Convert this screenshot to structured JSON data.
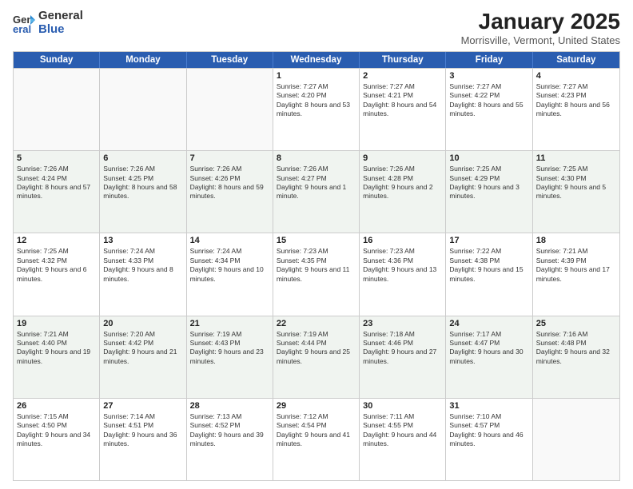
{
  "header": {
    "logo_general": "General",
    "logo_blue": "Blue",
    "month_title": "January 2025",
    "location": "Morrisville, Vermont, United States"
  },
  "days_of_week": [
    "Sunday",
    "Monday",
    "Tuesday",
    "Wednesday",
    "Thursday",
    "Friday",
    "Saturday"
  ],
  "weeks": [
    [
      {
        "day": "",
        "sunrise": "",
        "sunset": "",
        "daylight": ""
      },
      {
        "day": "",
        "sunrise": "",
        "sunset": "",
        "daylight": ""
      },
      {
        "day": "",
        "sunrise": "",
        "sunset": "",
        "daylight": ""
      },
      {
        "day": "1",
        "sunrise": "Sunrise: 7:27 AM",
        "sunset": "Sunset: 4:20 PM",
        "daylight": "Daylight: 8 hours and 53 minutes."
      },
      {
        "day": "2",
        "sunrise": "Sunrise: 7:27 AM",
        "sunset": "Sunset: 4:21 PM",
        "daylight": "Daylight: 8 hours and 54 minutes."
      },
      {
        "day": "3",
        "sunrise": "Sunrise: 7:27 AM",
        "sunset": "Sunset: 4:22 PM",
        "daylight": "Daylight: 8 hours and 55 minutes."
      },
      {
        "day": "4",
        "sunrise": "Sunrise: 7:27 AM",
        "sunset": "Sunset: 4:23 PM",
        "daylight": "Daylight: 8 hours and 56 minutes."
      }
    ],
    [
      {
        "day": "5",
        "sunrise": "Sunrise: 7:26 AM",
        "sunset": "Sunset: 4:24 PM",
        "daylight": "Daylight: 8 hours and 57 minutes."
      },
      {
        "day": "6",
        "sunrise": "Sunrise: 7:26 AM",
        "sunset": "Sunset: 4:25 PM",
        "daylight": "Daylight: 8 hours and 58 minutes."
      },
      {
        "day": "7",
        "sunrise": "Sunrise: 7:26 AM",
        "sunset": "Sunset: 4:26 PM",
        "daylight": "Daylight: 8 hours and 59 minutes."
      },
      {
        "day": "8",
        "sunrise": "Sunrise: 7:26 AM",
        "sunset": "Sunset: 4:27 PM",
        "daylight": "Daylight: 9 hours and 1 minute."
      },
      {
        "day": "9",
        "sunrise": "Sunrise: 7:26 AM",
        "sunset": "Sunset: 4:28 PM",
        "daylight": "Daylight: 9 hours and 2 minutes."
      },
      {
        "day": "10",
        "sunrise": "Sunrise: 7:25 AM",
        "sunset": "Sunset: 4:29 PM",
        "daylight": "Daylight: 9 hours and 3 minutes."
      },
      {
        "day": "11",
        "sunrise": "Sunrise: 7:25 AM",
        "sunset": "Sunset: 4:30 PM",
        "daylight": "Daylight: 9 hours and 5 minutes."
      }
    ],
    [
      {
        "day": "12",
        "sunrise": "Sunrise: 7:25 AM",
        "sunset": "Sunset: 4:32 PM",
        "daylight": "Daylight: 9 hours and 6 minutes."
      },
      {
        "day": "13",
        "sunrise": "Sunrise: 7:24 AM",
        "sunset": "Sunset: 4:33 PM",
        "daylight": "Daylight: 9 hours and 8 minutes."
      },
      {
        "day": "14",
        "sunrise": "Sunrise: 7:24 AM",
        "sunset": "Sunset: 4:34 PM",
        "daylight": "Daylight: 9 hours and 10 minutes."
      },
      {
        "day": "15",
        "sunrise": "Sunrise: 7:23 AM",
        "sunset": "Sunset: 4:35 PM",
        "daylight": "Daylight: 9 hours and 11 minutes."
      },
      {
        "day": "16",
        "sunrise": "Sunrise: 7:23 AM",
        "sunset": "Sunset: 4:36 PM",
        "daylight": "Daylight: 9 hours and 13 minutes."
      },
      {
        "day": "17",
        "sunrise": "Sunrise: 7:22 AM",
        "sunset": "Sunset: 4:38 PM",
        "daylight": "Daylight: 9 hours and 15 minutes."
      },
      {
        "day": "18",
        "sunrise": "Sunrise: 7:21 AM",
        "sunset": "Sunset: 4:39 PM",
        "daylight": "Daylight: 9 hours and 17 minutes."
      }
    ],
    [
      {
        "day": "19",
        "sunrise": "Sunrise: 7:21 AM",
        "sunset": "Sunset: 4:40 PM",
        "daylight": "Daylight: 9 hours and 19 minutes."
      },
      {
        "day": "20",
        "sunrise": "Sunrise: 7:20 AM",
        "sunset": "Sunset: 4:42 PM",
        "daylight": "Daylight: 9 hours and 21 minutes."
      },
      {
        "day": "21",
        "sunrise": "Sunrise: 7:19 AM",
        "sunset": "Sunset: 4:43 PM",
        "daylight": "Daylight: 9 hours and 23 minutes."
      },
      {
        "day": "22",
        "sunrise": "Sunrise: 7:19 AM",
        "sunset": "Sunset: 4:44 PM",
        "daylight": "Daylight: 9 hours and 25 minutes."
      },
      {
        "day": "23",
        "sunrise": "Sunrise: 7:18 AM",
        "sunset": "Sunset: 4:46 PM",
        "daylight": "Daylight: 9 hours and 27 minutes."
      },
      {
        "day": "24",
        "sunrise": "Sunrise: 7:17 AM",
        "sunset": "Sunset: 4:47 PM",
        "daylight": "Daylight: 9 hours and 30 minutes."
      },
      {
        "day": "25",
        "sunrise": "Sunrise: 7:16 AM",
        "sunset": "Sunset: 4:48 PM",
        "daylight": "Daylight: 9 hours and 32 minutes."
      }
    ],
    [
      {
        "day": "26",
        "sunrise": "Sunrise: 7:15 AM",
        "sunset": "Sunset: 4:50 PM",
        "daylight": "Daylight: 9 hours and 34 minutes."
      },
      {
        "day": "27",
        "sunrise": "Sunrise: 7:14 AM",
        "sunset": "Sunset: 4:51 PM",
        "daylight": "Daylight: 9 hours and 36 minutes."
      },
      {
        "day": "28",
        "sunrise": "Sunrise: 7:13 AM",
        "sunset": "Sunset: 4:52 PM",
        "daylight": "Daylight: 9 hours and 39 minutes."
      },
      {
        "day": "29",
        "sunrise": "Sunrise: 7:12 AM",
        "sunset": "Sunset: 4:54 PM",
        "daylight": "Daylight: 9 hours and 41 minutes."
      },
      {
        "day": "30",
        "sunrise": "Sunrise: 7:11 AM",
        "sunset": "Sunset: 4:55 PM",
        "daylight": "Daylight: 9 hours and 44 minutes."
      },
      {
        "day": "31",
        "sunrise": "Sunrise: 7:10 AM",
        "sunset": "Sunset: 4:57 PM",
        "daylight": "Daylight: 9 hours and 46 minutes."
      },
      {
        "day": "",
        "sunrise": "",
        "sunset": "",
        "daylight": ""
      }
    ]
  ]
}
